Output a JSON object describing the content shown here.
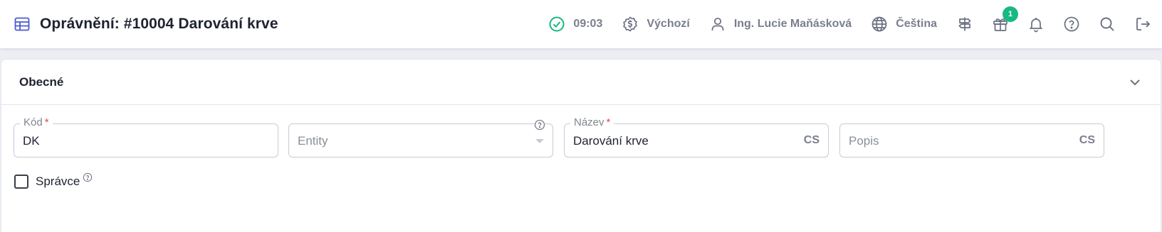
{
  "header": {
    "title": "Oprávnění: #10004 Darování krve",
    "time": "09:03",
    "profile": "Výchozí",
    "user": "Ing. Lucie Maňásková",
    "language": "Čeština",
    "gift_badge": "1"
  },
  "section": {
    "title": "Obecné"
  },
  "form": {
    "kod": {
      "label": "Kód",
      "required_mark": "*",
      "value": "DK"
    },
    "entity": {
      "placeholder": "Entity"
    },
    "nazev": {
      "label": "Název",
      "required_mark": "*",
      "value": "Darování krve",
      "lang": "CS"
    },
    "popis": {
      "placeholder": "Popis",
      "lang": "CS"
    },
    "spravce": {
      "label": "Správce",
      "checked": false
    }
  },
  "colors": {
    "accent": "#4a5bd0",
    "success": "#16b981",
    "required": "#e5484d"
  }
}
